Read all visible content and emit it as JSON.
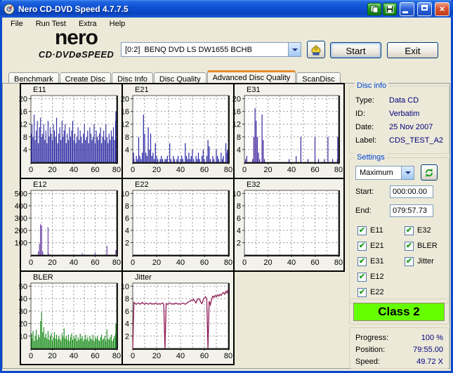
{
  "window": {
    "title": "Nero CD-DVD Speed 4.7.7.5"
  },
  "icons": {
    "close": "×",
    "check": "✔",
    "dropdown": "▼"
  },
  "menu": {
    "items": [
      "File",
      "Run Test",
      "Extra",
      "Help"
    ]
  },
  "logo": {
    "line1": "nero",
    "line2": "CD·DVDøSPEED"
  },
  "toolbar": {
    "drive": "[0:2]  BENQ DVD LS DW1655 BCHB",
    "start_label": "Start",
    "exit_label": "Exit"
  },
  "tabs": {
    "items": [
      {
        "label": "Benchmark",
        "active": false
      },
      {
        "label": "Create Disc",
        "active": false
      },
      {
        "label": "Disc Info",
        "active": false
      },
      {
        "label": "Disc Quality",
        "active": false
      },
      {
        "label": "Advanced Disc Quality",
        "active": true
      },
      {
        "label": "ScanDisc",
        "active": false
      }
    ]
  },
  "disc_info": {
    "title": "Disc info",
    "rows": [
      {
        "label": "Type:",
        "value": "Data CD"
      },
      {
        "label": "ID:",
        "value": "Verbatim"
      },
      {
        "label": "Date:",
        "value": "25 Nov 2007"
      },
      {
        "label": "Label:",
        "value": "CDS_TEST_A2"
      }
    ]
  },
  "settings": {
    "title": "Settings",
    "mode": "Maximum",
    "start_label": "Start:",
    "start_value": "000:00.00",
    "end_label": "End:",
    "end_value": "079:57.73",
    "checkboxes_left": [
      "E11",
      "E21",
      "E31",
      "E12",
      "E22"
    ],
    "checkboxes_right": [
      "E32",
      "BLER",
      "Jitter"
    ],
    "all_checked": true
  },
  "classification": {
    "label": "Class 2",
    "color": "#66FF00"
  },
  "progress": {
    "rows": [
      {
        "label": "Progress:",
        "value": "100 %"
      },
      {
        "label": "Position:",
        "value": "79:55.00"
      },
      {
        "label": "Speed:",
        "value": "49.72 X"
      }
    ]
  },
  "chart_data": [
    {
      "name": "E11",
      "title": "E11",
      "type": "bar",
      "color": "#201F9E",
      "yticks": [
        4,
        8,
        12,
        16,
        20
      ],
      "xticks": [
        0,
        20,
        40,
        60,
        80
      ],
      "xmax": 80,
      "values": [
        9,
        12,
        8,
        15,
        7,
        10,
        13,
        6,
        11,
        14,
        8,
        9,
        12,
        7,
        10,
        6,
        13,
        8,
        11,
        9,
        7,
        12,
        10,
        8,
        14,
        6,
        9,
        11,
        7,
        13,
        8,
        10,
        12,
        6,
        9,
        7,
        11,
        8,
        10,
        13,
        7,
        9,
        6,
        8,
        11,
        7,
        10,
        8,
        6,
        9,
        12,
        7,
        8,
        10,
        6,
        11,
        9,
        7,
        8,
        12,
        6,
        10,
        8,
        7,
        9,
        11,
        6,
        8,
        10,
        7,
        12,
        8,
        6,
        9,
        7,
        10,
        8,
        11,
        7,
        13,
        16
      ]
    },
    {
      "name": "E21",
      "title": "E21",
      "type": "bar",
      "color": "#2B28A4",
      "yticks": [
        4,
        8,
        12,
        16,
        20
      ],
      "xticks": [
        0,
        20,
        40,
        60,
        80
      ],
      "xmax": 80,
      "values": [
        3,
        1,
        0,
        2,
        1,
        8,
        2,
        1,
        3,
        15,
        9,
        3,
        2,
        11,
        4,
        9,
        2,
        3,
        1,
        6,
        2,
        1,
        0,
        1,
        2,
        1,
        0,
        1,
        1,
        2,
        0,
        6,
        1,
        0,
        2,
        1,
        0,
        1,
        2,
        0,
        1,
        2,
        1,
        0,
        6,
        2,
        1,
        3,
        1,
        2,
        4,
        1,
        0,
        2,
        1,
        3,
        1,
        0,
        2,
        4,
        1,
        0,
        2,
        7,
        5,
        1,
        0,
        2,
        1,
        0,
        4,
        2,
        1,
        0,
        3,
        1,
        2,
        0,
        6,
        3,
        4
      ]
    },
    {
      "name": "E31",
      "title": "E31",
      "type": "bar",
      "color": "#41269F",
      "yticks": [
        4,
        8,
        12,
        16,
        20
      ],
      "xticks": [
        0,
        20,
        40,
        60,
        80
      ],
      "xmax": 80,
      "values": [
        0,
        1,
        2,
        0,
        0,
        0,
        0,
        1,
        8,
        17,
        13,
        8,
        3,
        1,
        0,
        15,
        7,
        1,
        0,
        0,
        0,
        0,
        0,
        0,
        0,
        0,
        0,
        0,
        0,
        0,
        0,
        0,
        0,
        0,
        0,
        0,
        0,
        0,
        1,
        0,
        0,
        0,
        0,
        0,
        2,
        0,
        0,
        0,
        8,
        0,
        0,
        0,
        0,
        0,
        1,
        0,
        0,
        0,
        0,
        0,
        8,
        0,
        0,
        1,
        0,
        0,
        0,
        0,
        1,
        0,
        0,
        8,
        0,
        0,
        0,
        1,
        0,
        0,
        0,
        1,
        8
      ]
    },
    {
      "name": "E12",
      "title": "E12",
      "type": "bar",
      "color": "#5F2D9C",
      "yticks": [
        100,
        200,
        300,
        400,
        500
      ],
      "xticks": [
        0,
        20,
        40,
        60,
        80
      ],
      "xmax": 80,
      "values": [
        0,
        0,
        0,
        0,
        0,
        0,
        0,
        30,
        90,
        250,
        240,
        30,
        5,
        0,
        0,
        0,
        225,
        10,
        0,
        0,
        0,
        0,
        0,
        0,
        0,
        0,
        0,
        0,
        0,
        0,
        0,
        0,
        0,
        0,
        0,
        0,
        0,
        0,
        0,
        0,
        0,
        0,
        0,
        0,
        0,
        0,
        0,
        0,
        15,
        0,
        0,
        0,
        0,
        0,
        0,
        0,
        0,
        0,
        0,
        0,
        20,
        0,
        0,
        0,
        0,
        0,
        0,
        0,
        0,
        0,
        0,
        75,
        0,
        0,
        0,
        0,
        0,
        0,
        0,
        0,
        40
      ]
    },
    {
      "name": "E22",
      "title": "E22",
      "type": "bar",
      "color": "#2B28A4",
      "yticks": [
        2,
        4,
        6,
        8,
        10
      ],
      "xticks": [
        0,
        20,
        40,
        60,
        80
      ],
      "xmax": 80,
      "values": []
    },
    {
      "name": "E32",
      "title": "E32",
      "type": "bar",
      "color": "#41269F",
      "yticks": [
        2,
        4,
        6,
        8,
        10
      ],
      "xticks": [
        0,
        20,
        40,
        60,
        80
      ],
      "xmax": 80,
      "values": []
    },
    {
      "name": "BLER",
      "title": "BLER",
      "type": "bar",
      "color": "#0C870C",
      "yticks": [
        10,
        20,
        30,
        40,
        50
      ],
      "xticks": [
        0,
        20,
        40,
        60,
        80
      ],
      "xmax": 80,
      "values": [
        12,
        8,
        14,
        6,
        10,
        15,
        7,
        11,
        9,
        22,
        29,
        13,
        17,
        9,
        12,
        8,
        14,
        7,
        10,
        12,
        6,
        9,
        13,
        8,
        11,
        7,
        10,
        8,
        6,
        12,
        9,
        16,
        8,
        10,
        7,
        11,
        6,
        9,
        12,
        7,
        10,
        8,
        11,
        6,
        9,
        7,
        12,
        8,
        10,
        6,
        8,
        11,
        7,
        9,
        6,
        10,
        8,
        7,
        11,
        6,
        9,
        8,
        10,
        7,
        6,
        9,
        11,
        7,
        8,
        10,
        6,
        15,
        8,
        7,
        9,
        11,
        6,
        8,
        10,
        12,
        20
      ]
    },
    {
      "name": "Jitter",
      "title": "Jitter",
      "type": "line",
      "color": "#8E1A55",
      "yticks": [
        2,
        4,
        6,
        8,
        10
      ],
      "xticks": [
        0,
        20,
        40,
        60,
        80
      ],
      "xmax": 80,
      "values": [
        0,
        7.4,
        7.2,
        7.1,
        7.2,
        7.3,
        7.1,
        7.2,
        7.4,
        7.2,
        7.1,
        7.3,
        7.2,
        7.1,
        7.2,
        7.3,
        7.1,
        7.2,
        7.1,
        7.3,
        7.2,
        7.1,
        7.2,
        7.1,
        7.2,
        7.3,
        7.1,
        0,
        7.2,
        7.1,
        7.2,
        7.3,
        7.2,
        7.1,
        7.2,
        7.1,
        7.3,
        7.2,
        7.1,
        7.2,
        7.1,
        7.2,
        7.3,
        7.2,
        7.1,
        7.2,
        7.4,
        7.5,
        7.6,
        7.8,
        7.7,
        7.9,
        7.6,
        7.3,
        7.8,
        8.0,
        7.9,
        7.4,
        7.2,
        7.8,
        8.1,
        8.3,
        7.9,
        0,
        7.6,
        7.0,
        7.8,
        8.4,
        8.2,
        8.5,
        8.3,
        8.6,
        8.4,
        8.7,
        8.5,
        8.8,
        9.0,
        8.7,
        9.2,
        8.9,
        9.5
      ]
    }
  ]
}
